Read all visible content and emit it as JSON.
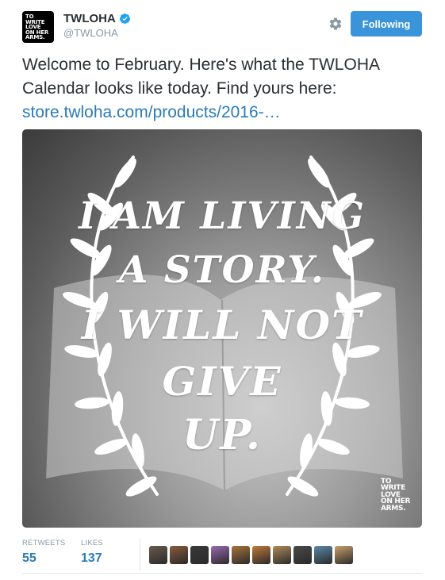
{
  "account": {
    "display_name": "TWLOHA",
    "handle": "@TWLOHA",
    "avatar_text": [
      "TO",
      "WRITE",
      "LOVE",
      "ON HER",
      "ARMS."
    ],
    "verified": true,
    "verified_color": "#1da1f2"
  },
  "actions": {
    "settings_icon": "gear-icon",
    "follow_label": "Following",
    "follow_color": "#3b94d9"
  },
  "tweet": {
    "text": "Welcome to February. Here's what the TWLOHA Calendar looks like today. Find yours here: ",
    "link": "store.twloha.com/products/2016-…",
    "link_color": "#2b7bb9"
  },
  "media": {
    "quote_lines": [
      "I AM LIVING",
      "A STORY.",
      "I WILL NOT",
      "GIVE",
      "UP."
    ],
    "logo_text": [
      "TO",
      "WRITE",
      "LOVE",
      "ON HER",
      "ARMS."
    ]
  },
  "stats": {
    "retweets_label": "RETWEETS",
    "retweets_value": "55",
    "likes_label": "LIKES",
    "likes_value": "137",
    "liker_avatar_colors": [
      "#6b5a4e",
      "#8a5a3c",
      "#3a3a3a",
      "#9a6ab0",
      "#a8743a",
      "#c07a3a",
      "#b08a5a",
      "#4a4a4a",
      "#5a8aa8",
      "#c9a06a"
    ]
  }
}
